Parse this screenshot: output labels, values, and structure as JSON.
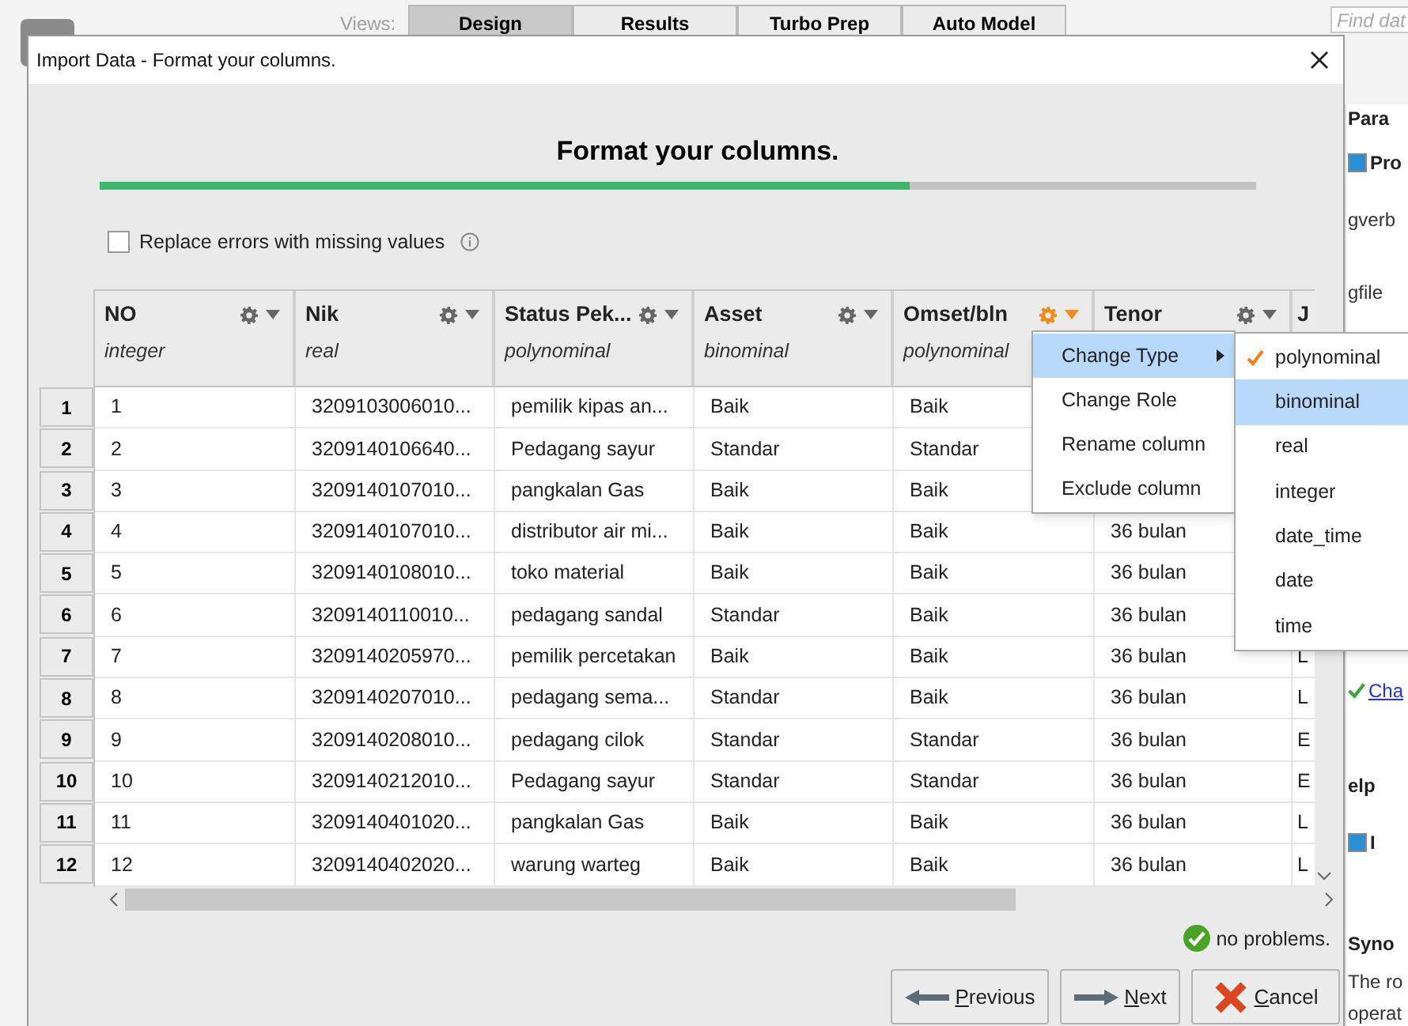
{
  "background": {
    "views_label": "Views:",
    "view_tabs": [
      {
        "label": "Design",
        "selected": true
      },
      {
        "label": "Results",
        "selected": false
      },
      {
        "label": "Turbo Prep",
        "selected": false
      },
      {
        "label": "Auto Model",
        "selected": false
      }
    ],
    "search": {
      "placeholder": "Find dat"
    },
    "side_texts": [
      {
        "kind": "heading",
        "text": "Para"
      },
      {
        "kind": "operator",
        "text": "Pro"
      },
      {
        "kind": "plain",
        "text": "gverb"
      },
      {
        "kind": "plain",
        "text": "gfile"
      },
      {
        "kind": "link",
        "text": "Cha"
      },
      {
        "kind": "heading",
        "text": "elp"
      },
      {
        "kind": "operator",
        "text": "I"
      },
      {
        "kind": "heading",
        "text": "Syno"
      },
      {
        "kind": "plain",
        "text": "The ro"
      },
      {
        "kind": "plain",
        "text": "operat"
      }
    ]
  },
  "dialog": {
    "title": "Import Data - Format your columns.",
    "heading": "Format your columns.",
    "progress": {
      "level": 0.7
    },
    "replace_errors": {
      "label": "Replace errors with missing values",
      "checked": false
    },
    "columns": [
      {
        "name": "NO",
        "type": "integer",
        "menu_open": false
      },
      {
        "name": "Nik",
        "type": "real",
        "menu_open": false
      },
      {
        "name": "Status Pek...",
        "type": "polynominal",
        "menu_open": false
      },
      {
        "name": "Asset",
        "type": "binominal",
        "menu_open": false
      },
      {
        "name": "Omset/bln",
        "type": "polynominal",
        "menu_open": true
      },
      {
        "name": "Tenor",
        "menu_open": false
      },
      {
        "name": "J"
      }
    ],
    "rows": [
      {
        "number": "1",
        "cells": [
          "1",
          "3209103006010...",
          "pemilik kipas an...",
          "Baik",
          "Baik"
        ]
      },
      {
        "number": "2",
        "cells": [
          "2",
          "3209140106640...",
          "Pedagang sayur",
          "Standar",
          "Standar"
        ]
      },
      {
        "number": "3",
        "cells": [
          "3",
          "3209140107010...",
          "pangkalan Gas",
          "Baik",
          "Baik"
        ]
      },
      {
        "number": "4",
        "cells": [
          "4",
          "3209140107010...",
          "distributor air mi...",
          "Baik",
          "Baik",
          "36 bulan"
        ]
      },
      {
        "number": "5",
        "cells": [
          "5",
          "3209140108010...",
          "toko material",
          "Baik",
          "Baik",
          "36 bulan"
        ]
      },
      {
        "number": "6",
        "cells": [
          "6",
          "3209140110010...",
          "pedagang sandal",
          "Standar",
          "Baik",
          "36 bulan"
        ]
      },
      {
        "number": "7",
        "cells": [
          "7",
          "3209140205970...",
          "pemilik percetakan",
          "Baik",
          "Baik",
          "36 bulan",
          "L"
        ]
      },
      {
        "number": "8",
        "cells": [
          "8",
          "3209140207010...",
          "pedagang sema...",
          "Standar",
          "Baik",
          "36 bulan",
          "L"
        ]
      },
      {
        "number": "9",
        "cells": [
          "9",
          "3209140208010...",
          "pedagang cilok",
          "Standar",
          "Standar",
          "36 bulan",
          "E"
        ]
      },
      {
        "number": "10",
        "cells": [
          "10",
          "3209140212010...",
          "Pedagang sayur",
          "Standar",
          "Standar",
          "36 bulan",
          "E"
        ]
      },
      {
        "number": "11",
        "cells": [
          "11",
          "3209140401020...",
          "pangkalan Gas",
          "Baik",
          "Baik",
          "36 bulan",
          "L"
        ]
      },
      {
        "number": "12",
        "cells": [
          "12",
          "3209140402020...",
          "warung warteg",
          "Baik",
          "Baik",
          "36 bulan",
          "L"
        ]
      }
    ],
    "status": "no problems.",
    "buttons": [
      {
        "kind": "previous",
        "label": "Previous"
      },
      {
        "kind": "next",
        "label": "Next"
      },
      {
        "kind": "cancel",
        "label": "Cancel"
      }
    ],
    "context_menu": [
      {
        "label": "Change Type",
        "selected": true,
        "submenu": true
      },
      {
        "label": "Change Role",
        "selected": false,
        "submenu": false
      },
      {
        "label": "Rename column",
        "selected": false,
        "submenu": false
      },
      {
        "label": "Exclude column",
        "selected": false,
        "submenu": false
      }
    ],
    "type_menu": [
      {
        "label": "polynominal",
        "checked": true,
        "selected": false
      },
      {
        "label": "binominal",
        "checked": false,
        "selected": true
      },
      {
        "label": "real",
        "checked": false,
        "selected": false
      },
      {
        "label": "integer",
        "checked": false,
        "selected": false
      },
      {
        "label": "date_time",
        "checked": false,
        "selected": false
      },
      {
        "label": "date",
        "checked": false,
        "selected": false
      },
      {
        "label": "time",
        "checked": false,
        "selected": false
      }
    ]
  }
}
